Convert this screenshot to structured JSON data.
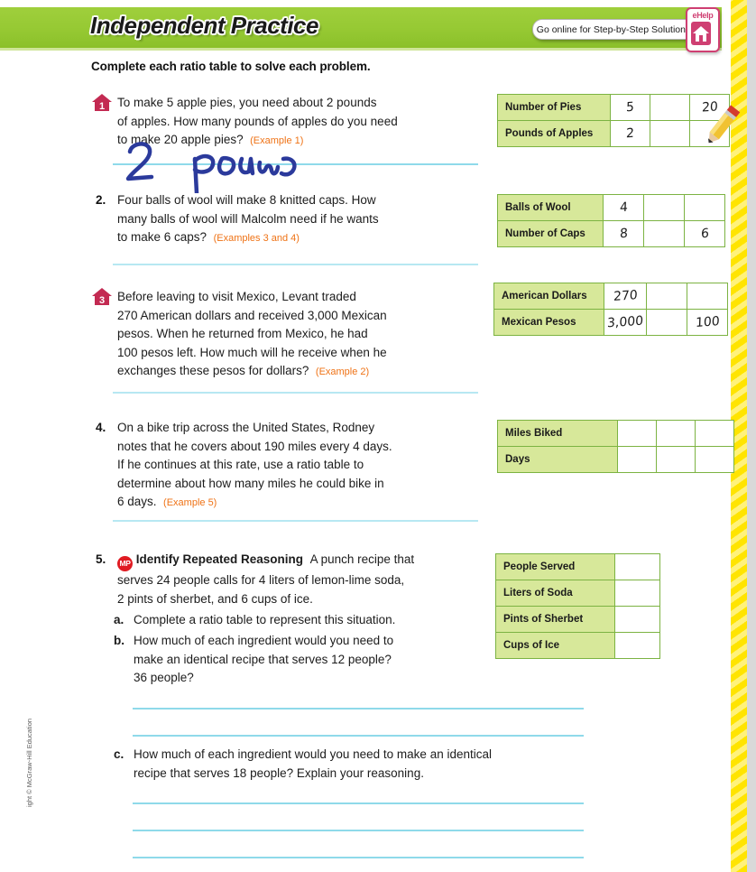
{
  "header": {
    "title": "Independent Practice",
    "go_online_label": "Go online for Step-by-Step Solutions",
    "ehelp_label": "eHelp",
    "ehelp_icon": "house-icon",
    "band_color": "#96c933"
  },
  "instruction": "Complete each ratio table to solve each problem.",
  "problems": [
    {
      "number": "1",
      "marker_type": "house",
      "line1": "To make 5 apple pies, you need about 2 pounds",
      "line2": "of apples. How many pounds of apples do you need",
      "line3": "to make 20 apple pies?",
      "example": "(Example 1)",
      "handwritten_answer": "2 pounds"
    },
    {
      "number": "2.",
      "marker_type": "number",
      "line1": "Four balls of wool will make 8 knitted caps. How",
      "line2": "many balls of wool will Malcolm need if he wants",
      "line3": "to make 6 caps?",
      "example": "(Examples 3 and 4)"
    },
    {
      "number": "3",
      "marker_type": "house",
      "line1": "Before leaving to visit Mexico, Levant traded",
      "line2": "270 American dollars and received 3,000 Mexican",
      "line3": "pesos. When he returned from Mexico, he had",
      "line4": "100 pesos left. How much will he receive when he",
      "line5": "exchanges these pesos for dollars?",
      "example": "(Example 2)"
    },
    {
      "number": "4.",
      "marker_type": "number",
      "line1": "On a bike trip across the United States, Rodney",
      "line2": "notes that he covers about 190 miles every 4 days.",
      "line3": "If he continues at this rate, use a ratio table to",
      "line4": "determine about how many miles he could bike in",
      "line5": "6 days.",
      "example": "(Example 5)"
    },
    {
      "number": "5.",
      "marker_type": "number",
      "badge": "MP",
      "bold_lead": "Identify Repeated Reasoning",
      "line1": "A punch recipe that",
      "line2": "serves 24 people calls for 4 liters of lemon-lime soda,",
      "line3": "2 pints of sherbet, and 6 cups of ice.",
      "sub": [
        {
          "letter": "a.",
          "line1": "Complete a ratio table to represent this situation."
        },
        {
          "letter": "b.",
          "line1": "How much of each ingredient would you need to",
          "line2": "make an identical recipe that serves 12 people?",
          "line3": "36 people?"
        },
        {
          "letter": "c.",
          "line1": "How much of each ingredient would you need to make an identical",
          "line2": "recipe that serves 18 people? Explain your reasoning."
        }
      ]
    }
  ],
  "tables": [
    {
      "id": "table-1",
      "rows": [
        {
          "label": "Number of Pies",
          "cells": [
            "5",
            "",
            "20"
          ]
        },
        {
          "label": "Pounds of Apples",
          "cells": [
            "2",
            "",
            ""
          ]
        }
      ]
    },
    {
      "id": "table-2",
      "rows": [
        {
          "label": "Balls of Wool",
          "cells": [
            "4",
            "",
            ""
          ]
        },
        {
          "label": "Number of Caps",
          "cells": [
            "8",
            "",
            "6"
          ]
        }
      ]
    },
    {
      "id": "table-3",
      "rows": [
        {
          "label": "American Dollars",
          "cells": [
            "270",
            "",
            ""
          ]
        },
        {
          "label": "Mexican Pesos",
          "cells": [
            "3,000",
            "",
            "100"
          ]
        }
      ]
    },
    {
      "id": "table-4",
      "rows": [
        {
          "label": "Miles Biked",
          "cells": [
            "",
            "",
            ""
          ]
        },
        {
          "label": "Days",
          "cells": [
            "",
            "",
            ""
          ]
        }
      ]
    },
    {
      "id": "table-5",
      "rows": [
        {
          "label": "People Served",
          "cells": [
            ""
          ]
        },
        {
          "label": "Liters of Soda",
          "cells": [
            ""
          ]
        },
        {
          "label": "Pints of Sherbet",
          "cells": [
            ""
          ]
        },
        {
          "label": "Cups of Ice",
          "cells": [
            ""
          ]
        }
      ]
    }
  ],
  "icons": {
    "pencil": "pencil-icon",
    "house": "house-icon"
  },
  "copyright": "ight © McGraw-Hill Education",
  "colors": {
    "header_green": "#96c933",
    "table_label_green": "#d7e89a",
    "table_border_green": "#7cb342",
    "rule_blue": "#8fdaea",
    "example_orange": "#ef7215",
    "house_crimson": "#c32a52",
    "mp_red": "#e01b22",
    "ehelp_pink": "#cf3f72"
  }
}
